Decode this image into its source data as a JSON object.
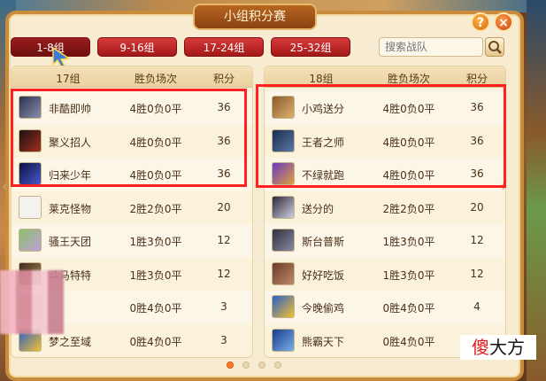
{
  "title": "小组积分赛",
  "watermark": "傻大方",
  "colors": {
    "accent": "#ff7a22",
    "tab_red": "#c02020",
    "highlight": "#ff2020"
  },
  "tabs": [
    {
      "label": "1-8组",
      "active": true
    },
    {
      "label": "9-16组",
      "active": false
    },
    {
      "label": "17-24组",
      "active": false
    },
    {
      "label": "25-32组",
      "active": false
    }
  ],
  "search": {
    "placeholder": "搜索战队",
    "icon": "search-icon"
  },
  "help_icon": "question-icon",
  "close_icon": "close-icon",
  "groups": [
    {
      "name": "17组",
      "col_record": "胜负场次",
      "col_points": "积分",
      "rows": [
        {
          "name": "非酷即帅",
          "record": "4胜0负0平",
          "points": "36"
        },
        {
          "name": "聚义招人",
          "record": "4胜0负0平",
          "points": "36"
        },
        {
          "name": "归来少年",
          "record": "4胜0负0平",
          "points": "36"
        },
        {
          "name": "莱克怪物",
          "record": "2胜2负0平",
          "points": "20"
        },
        {
          "name": "骚王天团",
          "record": "1胜3负0平",
          "points": "12"
        },
        {
          "name": "斗马特特",
          "record": "1胜3负0平",
          "points": "12"
        },
        {
          "name": "",
          "record": "0胜4负0平",
          "points": "3"
        },
        {
          "name": "梦之至域",
          "record": "0胜4负0平",
          "points": "3"
        }
      ]
    },
    {
      "name": "18组",
      "col_record": "胜负场次",
      "col_points": "积分",
      "rows": [
        {
          "name": "小鸡送分",
          "record": "4胜0负0平",
          "points": "36"
        },
        {
          "name": "王者之师",
          "record": "4胜0负0平",
          "points": "36"
        },
        {
          "name": "不绿就跑",
          "record": "4胜0负0平",
          "points": "36"
        },
        {
          "name": "送分的",
          "record": "2胜2负0平",
          "points": "20"
        },
        {
          "name": "斯台普斯",
          "record": "1胜3负0平",
          "points": "12"
        },
        {
          "name": "好好吃饭",
          "record": "1胜3负0平",
          "points": "12"
        },
        {
          "name": "今晚偷鸡",
          "record": "0胜4负0平",
          "points": "4"
        },
        {
          "name": "熊霸天下",
          "record": "0胜4负0平",
          "points": "3"
        }
      ]
    }
  ],
  "pager": {
    "pages": 4,
    "current": 1
  }
}
